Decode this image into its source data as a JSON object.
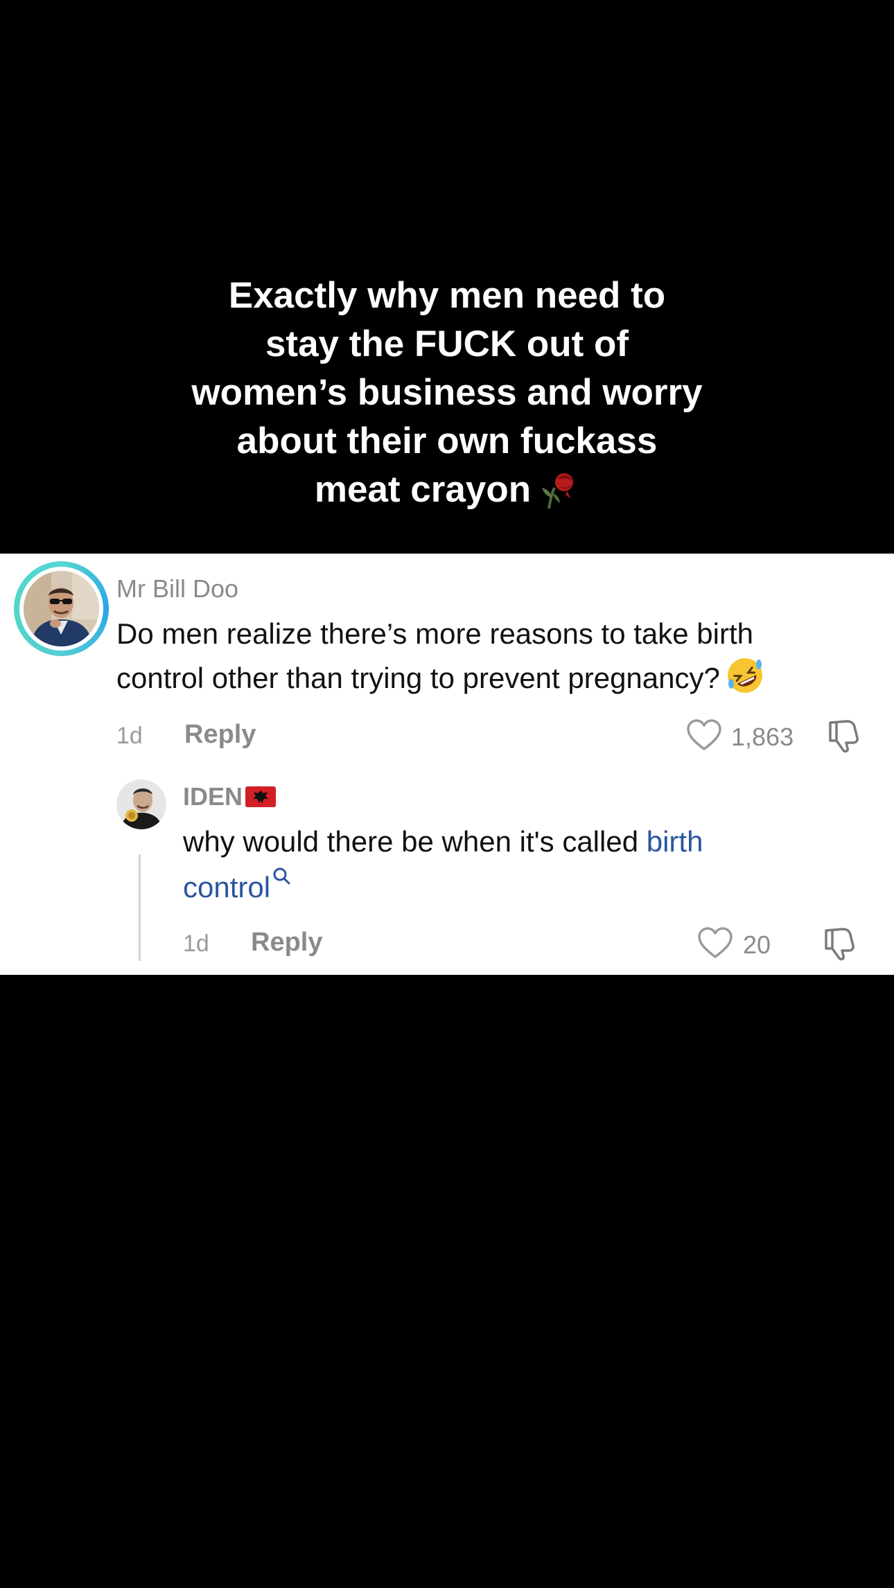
{
  "caption": {
    "lines": [
      "Exactly why men need to",
      "stay the FUCK out of",
      "women’s business and worry",
      "about their own fuckass",
      "meat crayon"
    ]
  },
  "comment": {
    "username": "Mr Bill Doo",
    "text_line1": "Do men realize there’s more reasons to take birth",
    "text_line2": "control other than trying to prevent pregnancy?",
    "time": "1d",
    "reply_label": "Reply",
    "likes": "1,863"
  },
  "reply": {
    "username": "IDEN",
    "text_line1": "why would there be when it's called ",
    "link_part1": "birth",
    "link_part2": "control",
    "time": "1d",
    "reply_label": "Reply",
    "likes": "20"
  },
  "colors": {
    "background": "#000000",
    "card": "#ffffff",
    "link": "#2a55a0",
    "avatar_ring": "#55d6d2",
    "muted_text": "#8a8a8a"
  },
  "icons": [
    "wilted-rose-icon",
    "rolling-laughing-emoji",
    "albania-flag-icon",
    "heart-icon",
    "thumbs-down-icon",
    "search-icon"
  ]
}
